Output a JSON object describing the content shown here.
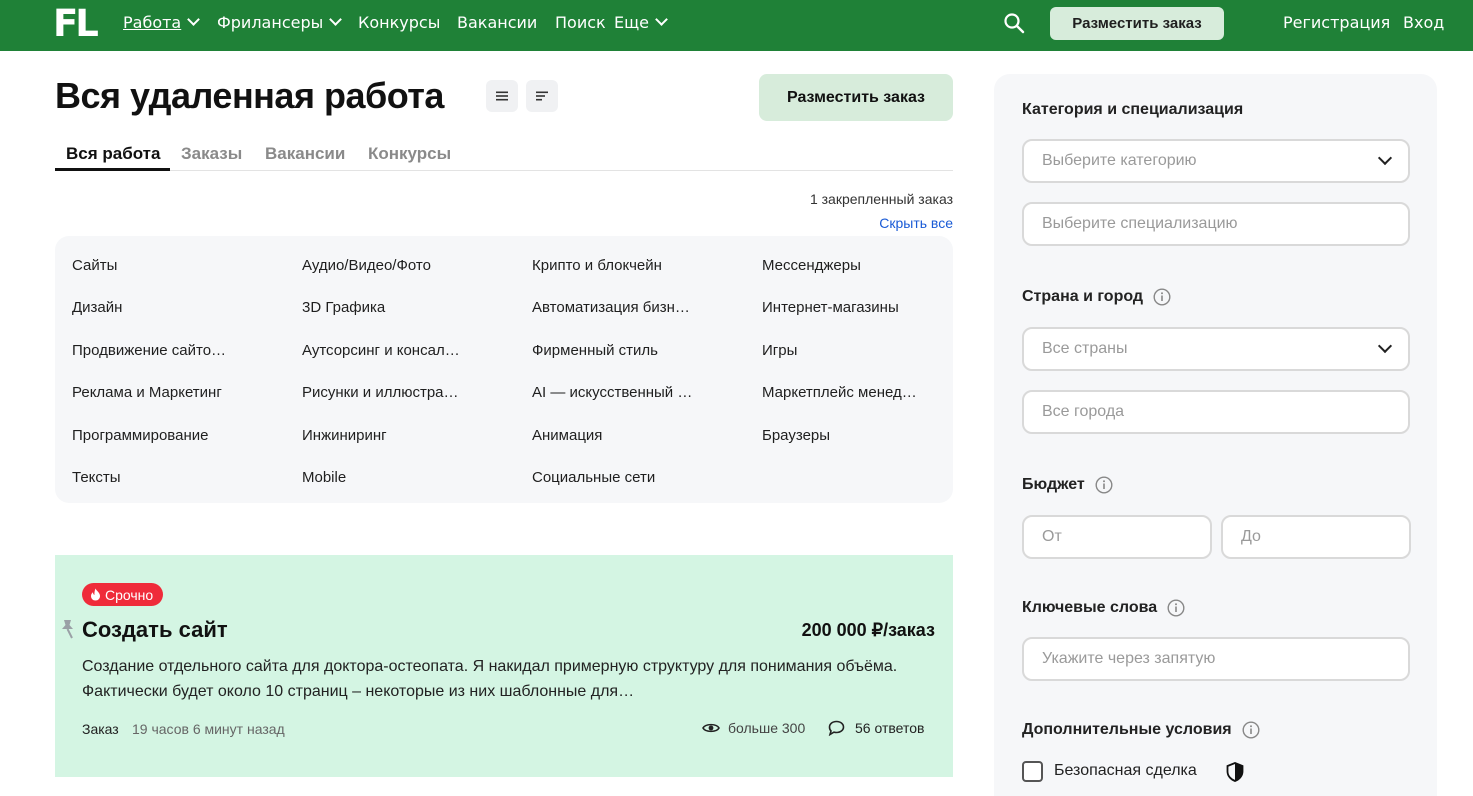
{
  "header": {
    "logo": "FL",
    "nav": [
      {
        "label": "Работа",
        "dropdown": true,
        "active": true
      },
      {
        "label": "Фрилансеры",
        "dropdown": true
      },
      {
        "label": "Конкурсы"
      },
      {
        "label": "Вакансии"
      },
      {
        "label": "Поиск"
      },
      {
        "label": "Еще",
        "dropdown": true
      }
    ],
    "search_icon": "search-icon",
    "post_order_label": "Разместить заказ",
    "register_label": "Регистрация",
    "login_label": "Вход"
  },
  "main": {
    "title": "Вся удаленная работа",
    "post_order_label": "Разместить заказ",
    "tabs": [
      "Вся работа",
      "Заказы",
      "Вакансии",
      "Конкурсы"
    ],
    "active_tab": 0,
    "pinned_count": "1 закрепленный заказ",
    "hide_all": "Скрыть все",
    "categories": [
      [
        "Сайты",
        "Дизайн",
        "Продвижение сайто…",
        "Реклама и Маркетинг",
        "Программирование",
        "Тексты"
      ],
      [
        "Аудио/Видео/Фото",
        "3D Графика",
        "Аутсорсинг и консал…",
        "Рисунки и иллюстра…",
        "Инжиниринг",
        "Mobile"
      ],
      [
        "Крипто и блокчейн",
        "Автоматизация бизн…",
        "Фирменный стиль",
        "AI — искусственный …",
        "Анимация",
        "Социальные сети"
      ],
      [
        "Мессенджеры",
        "Интернет-магазины",
        "Игры",
        "Маркетплейс менед…",
        "Браузеры"
      ]
    ]
  },
  "project": {
    "badge": "Срочно",
    "title": "Создать сайт",
    "price": "200 000 ₽/заказ",
    "description": "Создание отдельного сайта для доктора-остеопата. Я накидал примерную структуру для понимания объёма. Фактически будет около 10 страниц – некоторые из них шаблонные для…",
    "type": "Заказ",
    "time": "19 часов 6 минут назад",
    "views": "больше 300",
    "answers": "56 ответов"
  },
  "sidebar": {
    "category_label": "Категория и специализация",
    "category_placeholder": "Выберите категорию",
    "specialization_placeholder": "Выберите специализацию",
    "location_label": "Страна и город",
    "country_placeholder": "Все страны",
    "city_placeholder": "Все города",
    "budget_label": "Бюджет",
    "budget_from": "От",
    "budget_to": "До",
    "keywords_label": "Ключевые слова",
    "keywords_placeholder": "Укажите через запятую",
    "extra_label": "Дополнительные условия",
    "safe_deal_label": "Безопасная сделка"
  },
  "colors": {
    "header_bg": "#1f8137",
    "accent_button": "#d7ecdb",
    "card_bg": "#d4f5e3",
    "badge_red": "#ef2b3a",
    "link_blue": "#1a5bd6"
  }
}
